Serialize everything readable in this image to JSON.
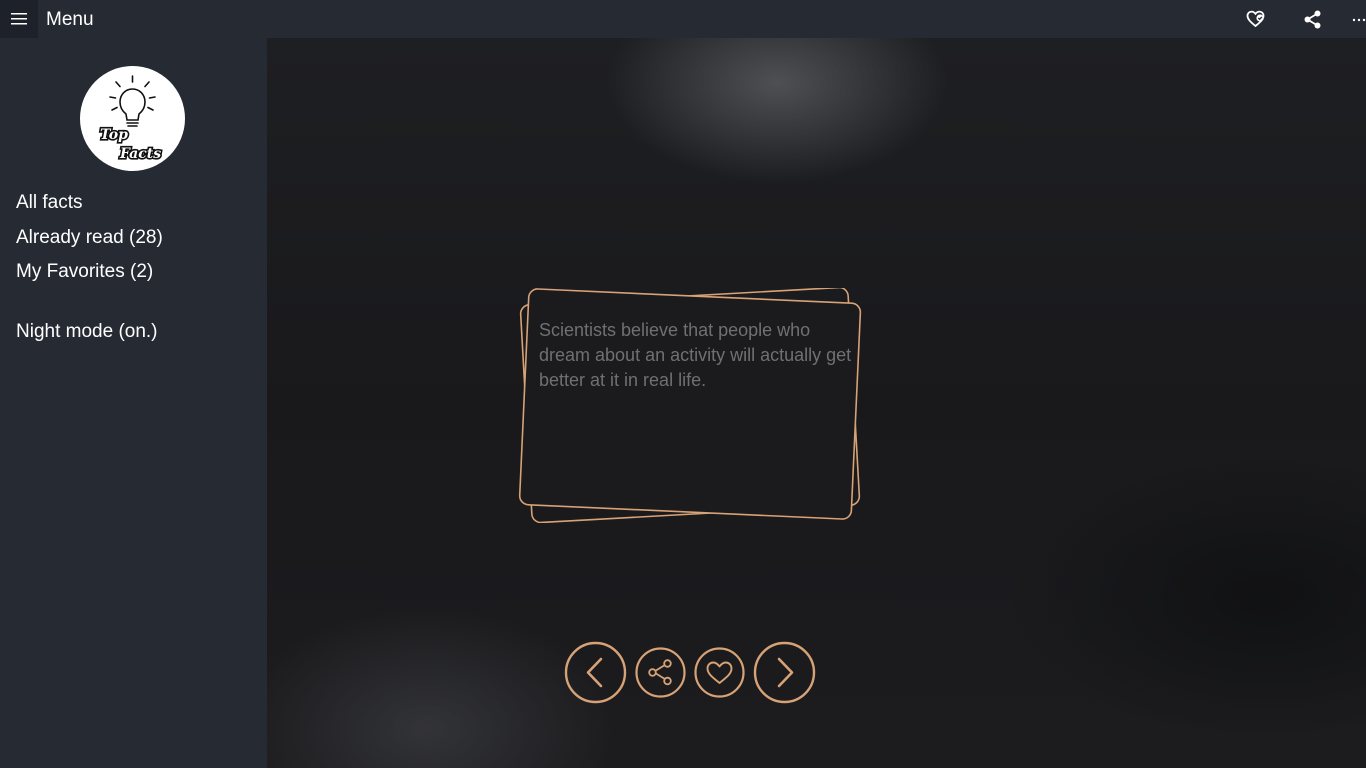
{
  "header": {
    "title": "Menu",
    "icons": [
      "hamburger-icon",
      "favorites-heart-icon",
      "share-icon",
      "more-icon"
    ]
  },
  "sidebar": {
    "logo": {
      "line1": "Top",
      "line2": "Facts"
    },
    "items": [
      {
        "label": "All facts"
      },
      {
        "label": "Already read (28)"
      },
      {
        "label": "My Favorites (2)"
      },
      {
        "label": "Night mode (on.)"
      }
    ]
  },
  "fact": {
    "text": "Scientists believe that people who dream about an activity will actually get better at it in real life."
  },
  "controls": [
    "previous-icon",
    "share-icon",
    "heart-icon",
    "next-icon"
  ],
  "colors": {
    "accent": "#d7a276",
    "sidebar_bg": "#252a33",
    "main_bg": "#1b1c1f",
    "fact_text": "#6f7073"
  }
}
